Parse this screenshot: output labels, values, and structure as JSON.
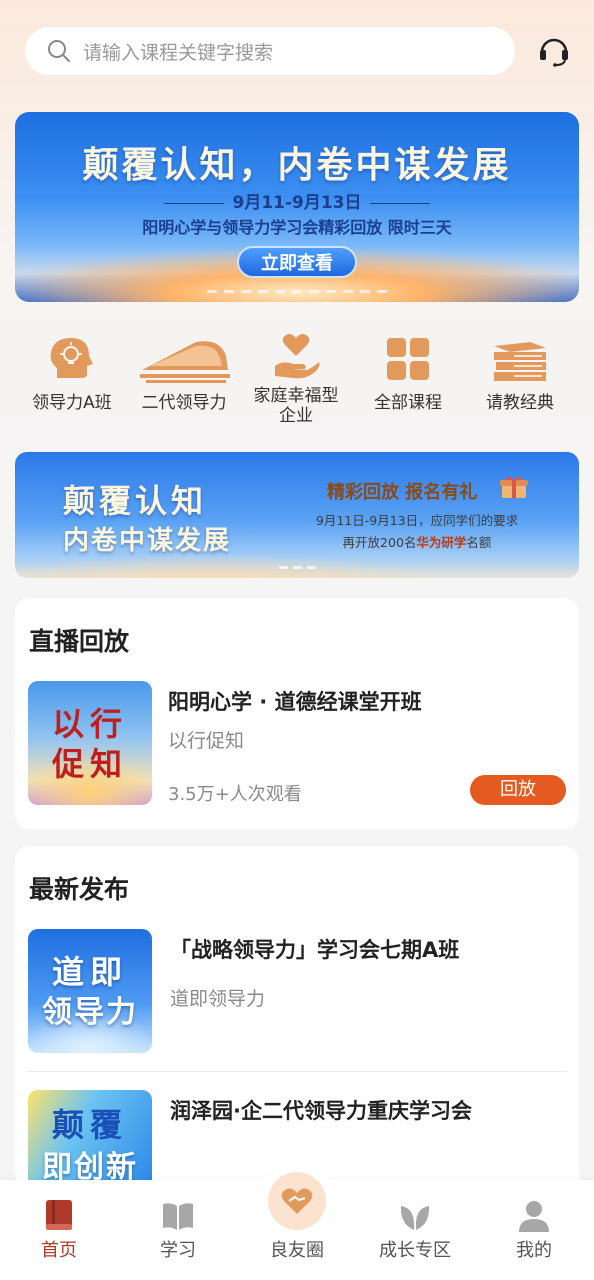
{
  "search": {
    "placeholder": "请输入课程关键字搜索"
  },
  "banner1": {
    "title": "颠覆认知，内卷中谋发展",
    "date": "9月11-9月13日",
    "subtitle": "阳明心学与领导力学习会精彩回放  限时三天",
    "button": "立即查看"
  },
  "nav": {
    "items": [
      {
        "label": "领导力A班",
        "icon": "head-bulb-icon"
      },
      {
        "label": "二代领导力",
        "icon": "train-icon"
      },
      {
        "label": "家庭幸福型企业",
        "icon": "hand-heart-icon"
      },
      {
        "label": "全部课程",
        "icon": "grid-icon"
      },
      {
        "label": "请教经典",
        "icon": "books-icon"
      }
    ],
    "label_line1": "家庭幸福型",
    "label_line2": "企业"
  },
  "banner2": {
    "title1": "颠覆认知",
    "title2": "内卷中谋发展",
    "headline": "精彩回放 报名有礼",
    "line1": "9月11日-9月13日，应同学们的要求",
    "line2_pre": "再开放200名",
    "line2_bold": "华为研学",
    "line2_post": "名额"
  },
  "live": {
    "section_title": "直播回放",
    "course": {
      "thumb_text1": "以行",
      "thumb_text2": "促知",
      "title": "阳明心学 · 道德经课堂开班",
      "subtitle": "以行促知",
      "views": "3.5万+人次观看",
      "button": "回放"
    }
  },
  "latest": {
    "section_title": "最新发布",
    "items": [
      {
        "thumb_text1": "道即",
        "thumb_text2": "领导力",
        "title": "「战略领导力」学习会七期A班",
        "subtitle": "道即领导力"
      },
      {
        "thumb_text1": "颠覆",
        "thumb_text2": "即创新",
        "title": "润泽园·企二代领导力重庆学习会",
        "subtitle": ""
      }
    ]
  },
  "tabbar": {
    "items": [
      {
        "label": "首页",
        "active": true
      },
      {
        "label": "学习",
        "active": false
      },
      {
        "label": "良友圈",
        "active": false
      },
      {
        "label": "成长专区",
        "active": false
      },
      {
        "label": "我的",
        "active": false
      }
    ]
  },
  "colors": {
    "accent": "#e55a1f",
    "active_tab": "#b0392a",
    "icon_orange": "#e29a5c"
  }
}
